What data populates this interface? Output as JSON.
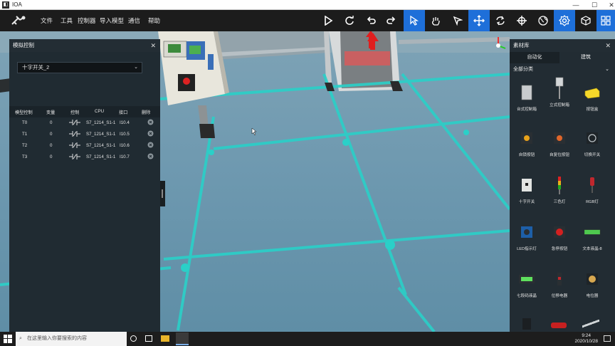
{
  "window": {
    "title": "IOA",
    "icon": "app-icon"
  },
  "menu": {
    "items": [
      "文件",
      "工具",
      "控制器",
      "导入模型",
      "通信",
      "帮助"
    ]
  },
  "toolbar": {
    "icons": [
      "play-icon",
      "refresh-icon",
      "undo-icon",
      "redo-icon",
      "select-cursor-icon",
      "hand-icon",
      "pointer-icon",
      "move-icon",
      "rotate-icon",
      "target-icon",
      "globe-icon",
      "settings-icon",
      "cube-icon",
      "grid-icon"
    ],
    "active": [
      "select-cursor-icon",
      "move-icon",
      "settings-icon",
      "grid-icon"
    ],
    "accent": "#1e6fd9"
  },
  "sim_panel": {
    "title": "模拟控制",
    "selected": "十字开关_2",
    "headers": [
      "模型控制",
      "变量",
      "控制",
      "CPU",
      "接口",
      "删除"
    ],
    "rows": [
      {
        "model": "T0",
        "var": "0",
        "cpu": "S7_1214_S1-1",
        "port": "I10.4"
      },
      {
        "model": "T1",
        "var": "0",
        "cpu": "S7_1214_S1-1",
        "port": "I10.5"
      },
      {
        "model": "T2",
        "var": "0",
        "cpu": "S7_1214_S1-1",
        "port": "I10.6"
      },
      {
        "model": "T3",
        "var": "0",
        "cpu": "S7_1214_S1-1",
        "port": "I10.7"
      }
    ]
  },
  "library": {
    "title": "素材库",
    "tabs": [
      "自动化",
      "建筑"
    ],
    "category": "全部分类",
    "items": [
      "台式控制箱",
      "立式控制箱",
      "按钮盒",
      "自锁按钮",
      "自复位按钮",
      "切换开关",
      "十字开关",
      "三色灯",
      "RGB灯",
      "LED指示灯",
      "急停按钮",
      "文本液晶-8",
      "七段码液晶",
      "位移电器",
      "电位器"
    ]
  },
  "taskbar": {
    "search_placeholder": "在这里输入你要搜索的内容",
    "time": "9:24",
    "date": "2020/10/28"
  }
}
